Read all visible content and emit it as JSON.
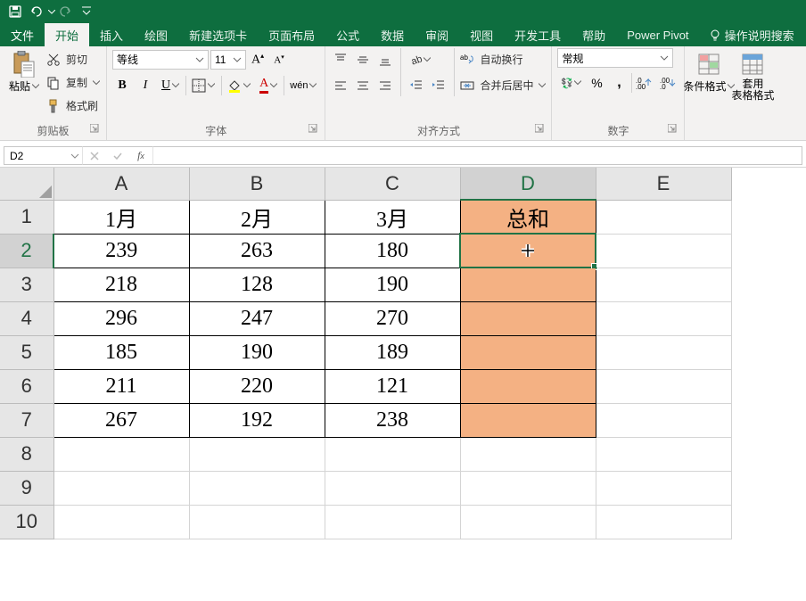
{
  "qat": {
    "save": "save-icon",
    "undo": "undo-icon",
    "redo": "redo-icon",
    "customize": "customize-icon"
  },
  "tabs": {
    "file": "文件",
    "items": [
      "开始",
      "插入",
      "绘图",
      "新建选项卡",
      "页面布局",
      "公式",
      "数据",
      "审阅",
      "视图",
      "开发工具",
      "帮助",
      "Power Pivot"
    ],
    "active_index": 0,
    "tellme": "操作说明搜索"
  },
  "ribbon": {
    "clipboard": {
      "paste": "粘贴",
      "cut": "剪切",
      "copy": "复制",
      "format_painter": "格式刷",
      "label": "剪贴板"
    },
    "font": {
      "family": "等线",
      "size": "11",
      "bold": "B",
      "italic": "I",
      "underline": "U",
      "phonetic": "wén",
      "increase_font_tooltip": "A",
      "decrease_font_tooltip": "A",
      "label": "字体"
    },
    "alignment": {
      "wrap": "自动换行",
      "merge": "合并后居中",
      "label": "对齐方式"
    },
    "number": {
      "format": "常规",
      "percent": "%",
      "comma": ",",
      "label": "数字"
    },
    "styles": {
      "conditional": "条件格式",
      "table": "套用\n表格格式"
    }
  },
  "namebox": "D2",
  "formula": "",
  "grid": {
    "columns": [
      "A",
      "B",
      "C",
      "D",
      "E"
    ],
    "selected_col": "D",
    "selected_row": 2,
    "rows": [
      {
        "n": 1,
        "A": "1月",
        "B": "2月",
        "C": "3月",
        "D": "总和"
      },
      {
        "n": 2,
        "A": "239",
        "B": "263",
        "C": "180",
        "D": ""
      },
      {
        "n": 3,
        "A": "218",
        "B": "128",
        "C": "190",
        "D": ""
      },
      {
        "n": 4,
        "A": "296",
        "B": "247",
        "C": "270",
        "D": ""
      },
      {
        "n": 5,
        "A": "185",
        "B": "190",
        "C": "189",
        "D": ""
      },
      {
        "n": 6,
        "A": "211",
        "B": "220",
        "C": "121",
        "D": ""
      },
      {
        "n": 7,
        "A": "267",
        "B": "192",
        "C": "238",
        "D": ""
      },
      {
        "n": 8
      },
      {
        "n": 9
      },
      {
        "n": 10
      }
    ]
  },
  "colors": {
    "accent": "#217346",
    "highlight": "#f4b183"
  }
}
